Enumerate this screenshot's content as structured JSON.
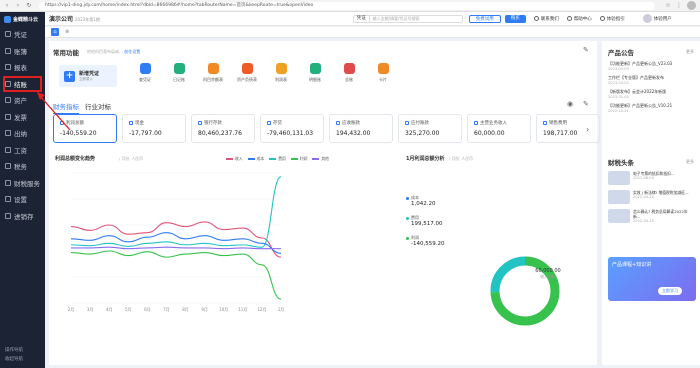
{
  "browser": {
    "url": "https://vip1-ding.jdy.com/home/index.html?dbId=8666986#/home?tabRouterName=首页&keepRoute=true&openVideo",
    "icons": [
      "back-icon",
      "forward-icon",
      "reload-icon",
      "star-icon",
      "extensions-icon",
      "profile-avatar"
    ]
  },
  "sidebar": {
    "logo": "金蝶精斗云",
    "items": [
      {
        "label": "凭证",
        "icon": "voucher-icon"
      },
      {
        "label": "账簿",
        "icon": "ledger-icon"
      },
      {
        "label": "报表",
        "icon": "report-icon"
      },
      {
        "label": "结账",
        "icon": "closing-icon"
      },
      {
        "label": "资产",
        "icon": "asset-icon"
      },
      {
        "label": "发票",
        "icon": "invoice-icon"
      },
      {
        "label": "出纳",
        "icon": "cashier-icon"
      },
      {
        "label": "工资",
        "icon": "salary-icon"
      },
      {
        "label": "税务",
        "icon": "tax-icon"
      },
      {
        "label": "财税服务",
        "icon": "service-icon"
      },
      {
        "label": "设置",
        "icon": "settings-icon"
      },
      {
        "label": "进销存",
        "icon": "inventory-icon"
      }
    ],
    "footer": [
      "操作导航",
      "收起导航"
    ]
  },
  "topbar": {
    "company": "演示公司",
    "period": "2023年第1期",
    "search_select": "凭证",
    "search_placeholder": "输入金额/摘要/凭证号搜索",
    "trial_btn": "免费试用",
    "buy_btn": "购买",
    "links": [
      "联系我们",
      "帮助中心",
      "体验指引",
      "体验用户"
    ]
  },
  "tabs": {
    "home_icon": "home-icon",
    "close": "⊗"
  },
  "common": {
    "title": "常用功能",
    "subtitle": "的地科目表布局或…",
    "setting_link": "前往设置",
    "new_voucher": "新增凭证",
    "new_voucher_sub": "立即录入",
    "quick": [
      {
        "label": "查凭证",
        "color": "#2f7cf6"
      },
      {
        "label": "日记账",
        "color": "#22b07d"
      },
      {
        "label": "科目余额表",
        "color": "#f08a24"
      },
      {
        "label": "资产负债表",
        "color": "#f05a24"
      },
      {
        "label": "利润表",
        "color": "#f0a024"
      },
      {
        "label": "明细账",
        "color": "#22b07d"
      },
      {
        "label": "总账",
        "color": "#e04b4b"
      },
      {
        "label": "卡片",
        "color": "#f08a24"
      }
    ]
  },
  "finance": {
    "tabs": [
      "财务指标",
      "行业对标"
    ],
    "cards": [
      {
        "label": "利润总额",
        "value": "-140,559.20"
      },
      {
        "label": "现金",
        "value": "-17,797.00"
      },
      {
        "label": "银行存款",
        "value": "80,460,237.76"
      },
      {
        "label": "存货",
        "value": "-79,460,131.03"
      },
      {
        "label": "应收账款",
        "value": "194,432.00"
      },
      {
        "label": "应付账款",
        "value": "325,270.00"
      },
      {
        "label": "主营业务收入",
        "value": "60,000.00"
      },
      {
        "label": "销售费用",
        "value": "198,717.00"
      }
    ]
  },
  "trend": {
    "title": "利润总额变化趋势",
    "unit": "/ 月份, 人民币",
    "legend": [
      {
        "name": "收入",
        "color": "#e0567a"
      },
      {
        "name": "成本",
        "color": "#2f7cf6"
      },
      {
        "name": "费用",
        "color": "#21c3c3"
      },
      {
        "name": "利润",
        "color": "#36c24d"
      },
      {
        "name": "其他",
        "color": "#8a6cf0"
      }
    ]
  },
  "chart_data": {
    "type": "line",
    "title": "利润总额变化趋势",
    "xlabel": "",
    "ylabel": "",
    "categories": [
      "2月",
      "3月",
      "4月",
      "5月",
      "6月",
      "7月",
      "8月",
      "9月",
      "10月",
      "11月",
      "12月",
      "1月"
    ],
    "series": [
      {
        "name": "收入",
        "values": [
          30,
          25,
          32,
          20,
          22,
          35,
          30,
          36,
          26,
          28,
          15,
          -10
        ]
      },
      {
        "name": "成本",
        "values": [
          14,
          12,
          18,
          10,
          16,
          22,
          14,
          18,
          12,
          14,
          8,
          -5
        ]
      },
      {
        "name": "费用",
        "values": [
          6,
          5,
          8,
          4,
          8,
          10,
          6,
          8,
          5,
          6,
          3,
          95
        ]
      },
      {
        "name": "利润",
        "values": [
          -4,
          -6,
          -2,
          -8,
          -3,
          -10,
          -6,
          -4,
          -8,
          -6,
          -20,
          -65
        ]
      },
      {
        "name": "其他",
        "values": [
          2,
          2,
          3,
          1,
          2,
          3,
          2,
          2,
          1,
          2,
          1,
          1
        ]
      }
    ],
    "ylim": [
      -70,
      100
    ]
  },
  "composition": {
    "title": "1月利润总额分析",
    "unit": "/ 月份, 人民币",
    "items": [
      {
        "label": "成本",
        "value": "1,042.20",
        "color": "#2f7cf6"
      },
      {
        "label": "费用",
        "value": "199,517.00",
        "color": "#21c3c3"
      },
      {
        "label": "利润",
        "value": "-140,559.20",
        "color": "#36c24d"
      }
    ],
    "center_value": "60,000.00",
    "center_label": "收入总额"
  },
  "right": {
    "notice_title": "产品公告",
    "more": "更多",
    "notices": [
      {
        "title": "【功能更新】产品更新公告_V23.03",
        "date": "2023-03-03"
      },
      {
        "title": "工作栏【专业版】产品更新发布",
        "date": "2023-03-02"
      },
      {
        "title": "【新版发布】云会计2022年新版",
        "date": "2023-01-05"
      },
      {
        "title": "【功能更新】产品更新公告_V10.21",
        "date": "2022-10-21"
      }
    ],
    "head_title": "财税头条",
    "heads": [
      {
        "title": "电子专票的抵扣和抵扣...",
        "date": "2021-06-04"
      },
      {
        "title": "实效 | 新法律! 增值税附加减征...",
        "date": "2022-04-20"
      },
      {
        "title": "怎么确认? 税务总局解读2022年新...",
        "date": "2022-04-15"
      }
    ],
    "banner_text": "产品课程+知识讲",
    "banner_btn": "立即学习"
  },
  "annotation": {
    "color": "#e02020"
  }
}
